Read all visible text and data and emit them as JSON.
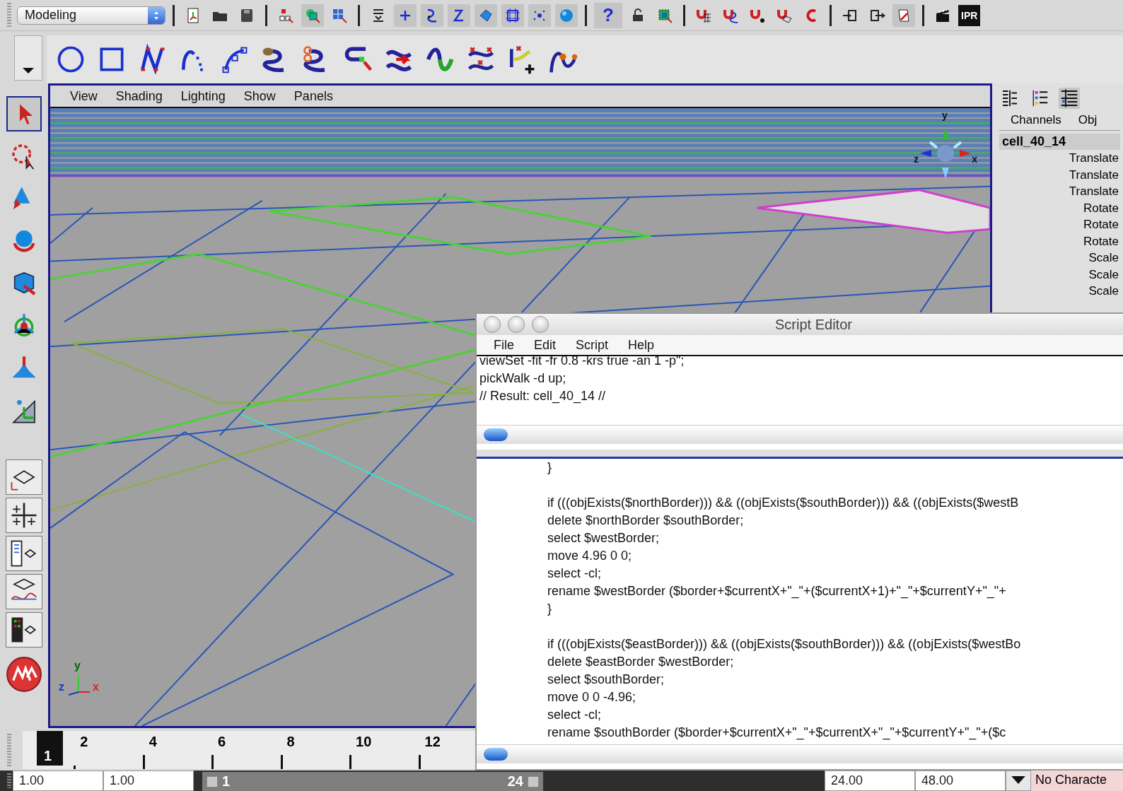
{
  "status_line": {
    "mode": "Modeling",
    "help_glyph": "?",
    "ipr_label": "IPR"
  },
  "viewport": {
    "menu": [
      "View",
      "Shading",
      "Lighting",
      "Show",
      "Panels"
    ],
    "view_cube_labels": [
      "y",
      "z",
      "x"
    ],
    "axis_labels": [
      "y",
      "z",
      "x"
    ]
  },
  "channel_box": {
    "tabs": [
      "Channels",
      "Obj"
    ],
    "object": "cell_40_14",
    "attributes": [
      "Translate",
      "Translate",
      "Translate",
      "Rotate",
      "Rotate",
      "Rotate",
      "Scale",
      "Scale",
      "Scale"
    ]
  },
  "script_editor": {
    "title": "Script Editor",
    "menu": [
      "File",
      "Edit",
      "Script",
      "Help"
    ],
    "history": [
      "viewSet -fit -fr 0.8 -krs true -an 1 -p\";",
      "pickWalk -d up;",
      "// Result: cell_40_14 //"
    ],
    "input_blocks": [
      [
        "}"
      ],
      [
        "if (((objExists($northBorder))) && ((objExists($southBorder))) && ((objExists($westB",
        "delete $northBorder $southBorder;",
        "select $westBorder;",
        "move 4.96 0 0;",
        "select -cl;",
        "rename $westBorder ($border+$currentX+\"_\"+($currentX+1)+\"_\"+$currentY+\"_\"+",
        "}"
      ],
      [
        "if (((objExists($eastBorder))) && ((objExists($southBorder))) && ((objExists($westBo",
        "delete $eastBorder $westBorder;",
        "select $southBorder;",
        "move 0 0 -4.96;",
        "select -cl;",
        "rename $southBorder ($border+$currentX+\"_\"+$currentX+\"_\"+$currentY+\"_\"+($c"
      ]
    ]
  },
  "timeline": {
    "frames": [
      {
        "label": "1",
        "selected": true
      },
      {
        "label": "2",
        "selected": false
      },
      {
        "label": "4",
        "selected": false
      },
      {
        "label": "6",
        "selected": false
      },
      {
        "label": "8",
        "selected": false
      },
      {
        "label": "10",
        "selected": false
      },
      {
        "label": "12",
        "selected": false
      }
    ]
  },
  "range": {
    "start": "1.00",
    "playback_start": "1.00",
    "slider_start": "1",
    "slider_end": "24",
    "playback_end": "24.00",
    "end": "48.00",
    "character_set": "No Characte"
  }
}
